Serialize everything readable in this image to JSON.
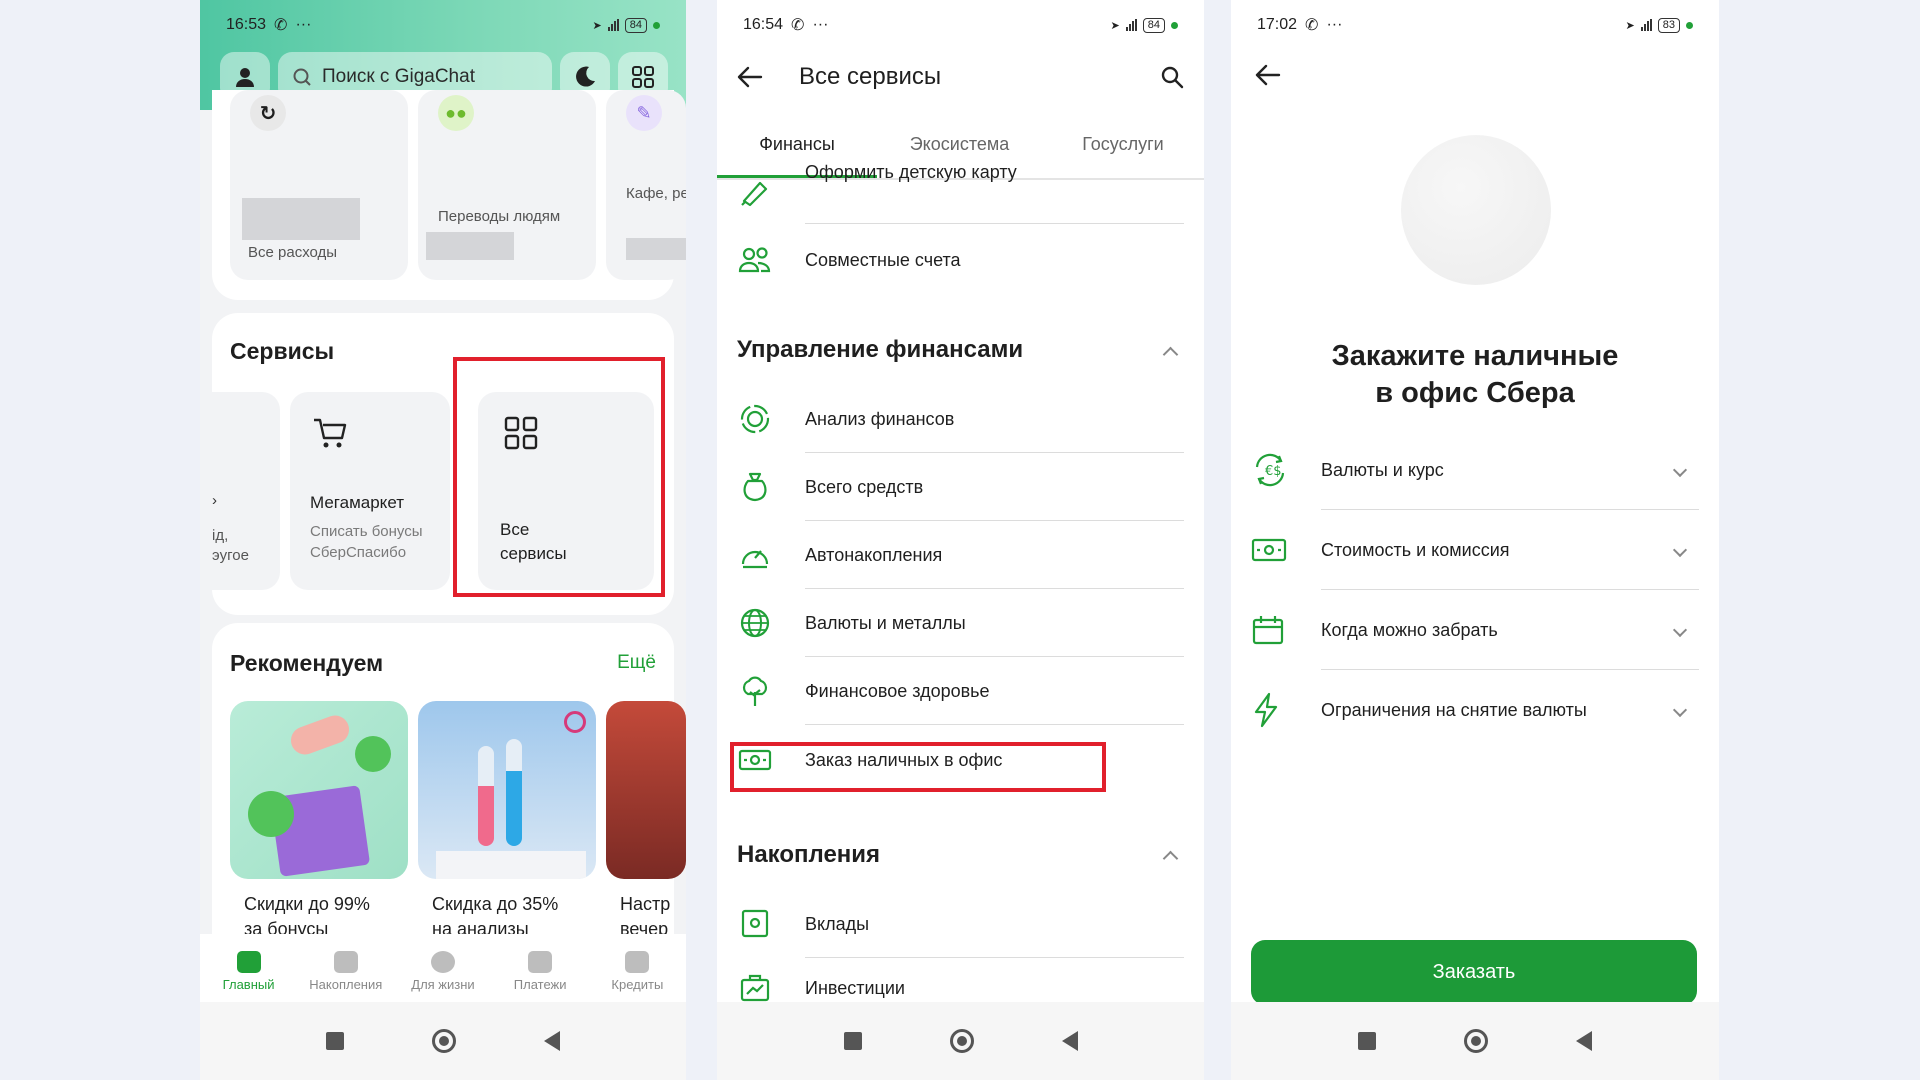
{
  "phone1": {
    "status": {
      "time": "16:53",
      "battery": "84"
    },
    "search_placeholder": "Поиск с GigaChat",
    "top_tiles": [
      {
        "label": "Все расходы"
      },
      {
        "label": "Переводы людям"
      },
      {
        "label": "Кафе, ресторан"
      }
    ],
    "services": {
      "title": "Сервисы",
      "partial_tile": {
        "line1": "›",
        "line2": "ід,",
        "line3": "эугое"
      },
      "megamarket": {
        "title": "Мегамаркет",
        "subtitle": "Списать бонусы СберСпасибо"
      },
      "all_services": {
        "line1": "Все",
        "line2": "сервисы"
      }
    },
    "recommend": {
      "title": "Рекомендуем",
      "more": "Ещё",
      "items": [
        {
          "line1": "Скидки до 99%",
          "line2": "за бонусы"
        },
        {
          "line1": "Скидка до 35%",
          "line2": "на анализы"
        },
        {
          "line1": "Настр",
          "line2": "вечер"
        }
      ]
    },
    "tabbar": [
      {
        "label": "Главный"
      },
      {
        "label": "Накопления"
      },
      {
        "label": "Для жизни"
      },
      {
        "label": "Платежи"
      },
      {
        "label": "Кредиты"
      }
    ],
    "colors": {
      "accent": "#21a038",
      "highlight": "#e1202c"
    }
  },
  "phone2": {
    "status": {
      "time": "16:54",
      "battery": "84"
    },
    "title": "Все сервисы",
    "tabs": [
      "Финансы",
      "Экосистема",
      "Госуслуги"
    ],
    "top_rows": [
      {
        "label": "Оформить детскую карту",
        "icon": "card-child-icon"
      },
      {
        "label": "Совместные счета",
        "icon": "people-icon"
      }
    ],
    "group1": {
      "title": "Управление финансами",
      "rows": [
        {
          "label": "Анализ финансов",
          "icon": "analysis-icon"
        },
        {
          "label": "Всего средств",
          "icon": "money-bag-icon"
        },
        {
          "label": "Автонакопления",
          "icon": "gauge-icon"
        },
        {
          "label": "Валюты и металлы",
          "icon": "globe-icon"
        },
        {
          "label": "Финансовое здоровье",
          "icon": "tree-icon"
        },
        {
          "label": "Заказ наличных в офис",
          "icon": "cash-icon"
        }
      ]
    },
    "group2": {
      "title": "Накопления",
      "rows": [
        {
          "label": "Вклады",
          "icon": "safe-icon"
        },
        {
          "label": "Инвестиции",
          "icon": "briefcase-chart-icon"
        }
      ]
    }
  },
  "phone3": {
    "status": {
      "time": "17:02",
      "battery": "83"
    },
    "title_line1": "Закажите наличные",
    "title_line2": "в офис Сбера",
    "rows": [
      {
        "label": "Валюты и курс",
        "icon": "currency-exchange-icon"
      },
      {
        "label": "Стоимость и комиссия",
        "icon": "banknote-icon"
      },
      {
        "label": "Когда можно забрать",
        "icon": "calendar-icon"
      },
      {
        "label": "Ограничения на снятие валюты",
        "icon": "lightning-icon"
      }
    ],
    "order_button": "Заказать"
  }
}
